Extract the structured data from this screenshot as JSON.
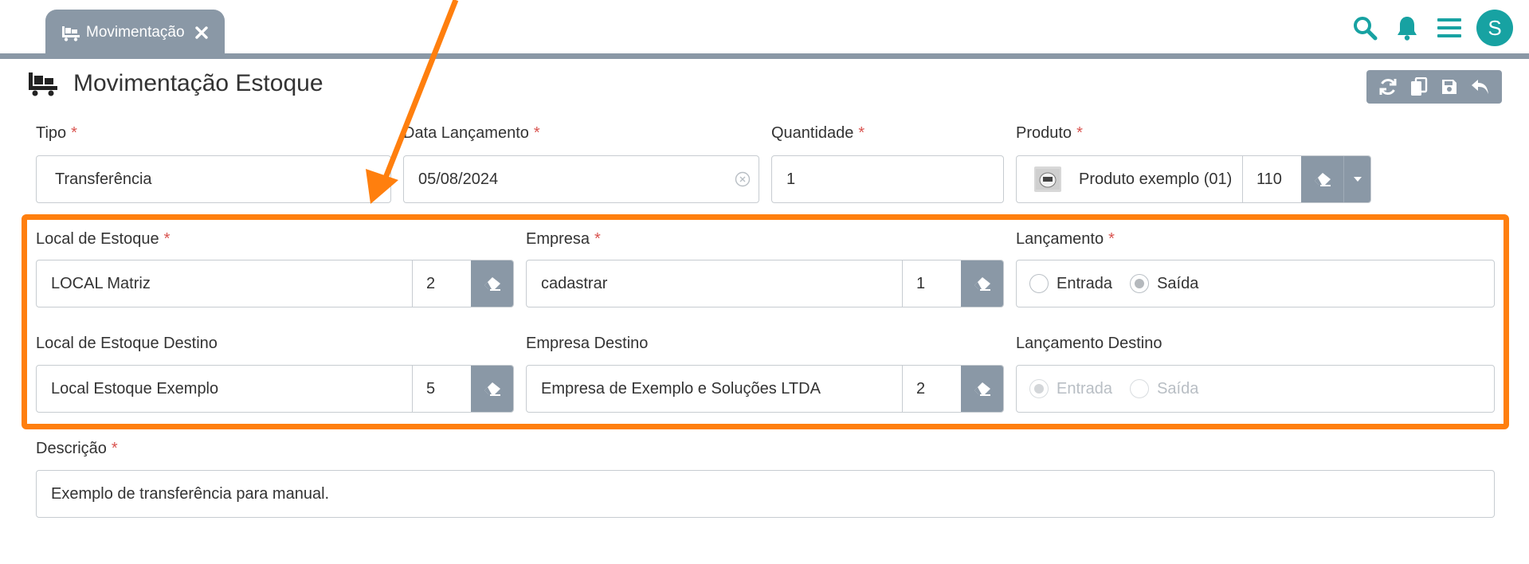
{
  "tab": {
    "label": "Movimentação"
  },
  "user": {
    "initial": "S"
  },
  "page": {
    "title": "Movimentação Estoque"
  },
  "required_mark": "*",
  "form": {
    "tipo": {
      "label": "Tipo",
      "value": "Transferência"
    },
    "data_lancamento": {
      "label": "Data Lançamento",
      "value": "05/08/2024"
    },
    "quantidade": {
      "label": "Quantidade",
      "value": "1"
    },
    "produto": {
      "label": "Produto",
      "value": "Produto exemplo (01)",
      "code": "110"
    },
    "local_estoque": {
      "label": "Local de Estoque",
      "value": "LOCAL Matriz",
      "code": "2"
    },
    "empresa": {
      "label": "Empresa",
      "value": "cadastrar",
      "code": "1"
    },
    "lancamento": {
      "label": "Lançamento",
      "options": [
        "Entrada",
        "Saída"
      ],
      "selected": "Saída"
    },
    "local_estoque_destino": {
      "label": "Local de Estoque Destino",
      "value": "Local Estoque Exemplo",
      "code": "5"
    },
    "empresa_destino": {
      "label": "Empresa Destino",
      "value": "Empresa de Exemplo e Soluções LTDA",
      "code": "2"
    },
    "lancamento_destino": {
      "label": "Lançamento Destino",
      "options": [
        "Entrada",
        "Saída"
      ],
      "selected": "Entrada",
      "disabled": true
    },
    "descricao": {
      "label": "Descrição",
      "value": "Exemplo de transferência para manual."
    }
  },
  "colors": {
    "accent": "#17a2a2",
    "header_gray": "#8a98a6",
    "annotation": "#ff7f0e",
    "required": "#d9534f"
  }
}
